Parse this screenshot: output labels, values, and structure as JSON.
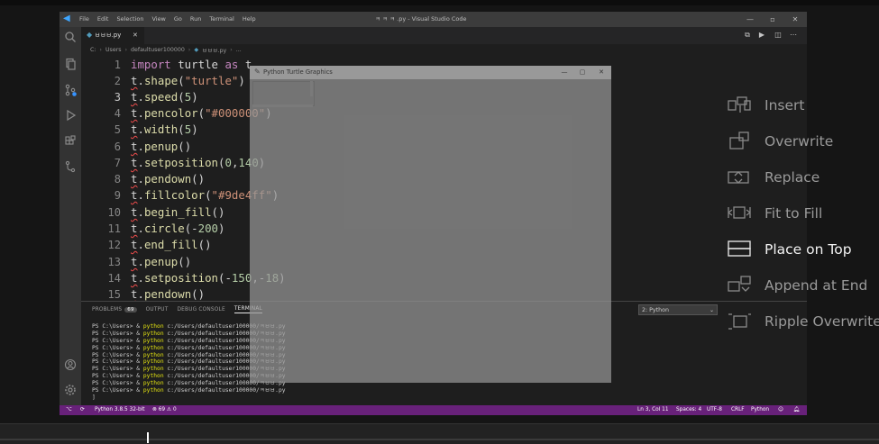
{
  "vscode": {
    "window_title": "ㅋ ㅋ ㅋ .py - Visual Studio Code",
    "menu": [
      "File",
      "Edit",
      "Selection",
      "View",
      "Go",
      "Run",
      "Terminal",
      "Help"
    ],
    "win_min": "—",
    "win_max": "▫",
    "win_close": "✕",
    "tab": {
      "label": "ㅂㅂㅂ.py",
      "close": "✕"
    },
    "breadcrumb": [
      "C:",
      "Users",
      "defaultuser100000",
      "ㅂㅂㅂ.py",
      "..."
    ],
    "code_lines": [
      {
        "n": "1",
        "t": "import turtle as t"
      },
      {
        "n": "2",
        "t": "t.shape(\"turtle\")"
      },
      {
        "n": "3",
        "t": "t.speed(5)"
      },
      {
        "n": "4",
        "t": "t.pencolor(\"#000000\")"
      },
      {
        "n": "5",
        "t": "t.width(5)"
      },
      {
        "n": "6",
        "t": "t.penup()"
      },
      {
        "n": "7",
        "t": "t.setposition(0,140)"
      },
      {
        "n": "8",
        "t": "t.pendown()"
      },
      {
        "n": "9",
        "t": "t.fillcolor(\"#9de4ff\")"
      },
      {
        "n": "10",
        "t": "t.begin_fill()"
      },
      {
        "n": "11",
        "t": "t.circle(-200)"
      },
      {
        "n": "12",
        "t": "t.end_fill()"
      },
      {
        "n": "13",
        "t": "t.penup()"
      },
      {
        "n": "14",
        "t": "t.setposition(-150,-18)"
      },
      {
        "n": "15",
        "t": "t.pendown()"
      }
    ],
    "turtle_window": {
      "title": "Python Turtle Graphics",
      "min": "—",
      "max": "▢",
      "close": "✕"
    },
    "panel": {
      "tabs": [
        "PROBLEMS",
        "OUTPUT",
        "DEBUG CONSOLE",
        "TERMINAL"
      ],
      "problems_count": "69",
      "terminal_select": "2: Python",
      "terminal_lines": [
        "PS C:\\Users> & python c:/Users/defaultuser100000/ㅋㅂㅂ.py",
        "PS C:\\Users> & python c:/Users/defaultuser100000/ㅋㅂㅂ.py",
        "PS C:\\Users> & python c:/Users/defaultuser100000/ㅋㅂㅂ.py",
        "PS C:\\Users> & python c:/Users/defaultuser100000/ㅋㅂㅂ.py",
        "PS C:\\Users> & python c:/Users/defaultuser100000/ㅋㅂㅂ.py",
        "PS C:\\Users> & python c:/Users/defaultuser100000/ㅋㅂㅂ.py",
        "PS C:\\Users> & python c:/Users/defaultuser100000/ㅋㅂㅂ.py",
        "PS C:\\Users> & python c:/Users/defaultuser100000/ㅋㅂㅂ.py",
        "PS C:\\Users> & python c:/Users/defaultuser100000/ㅋㅂㅂ.py",
        "PS C:\\Users> & python c:/Users/defaultuser100000/ㅋㅂㅂ.py",
        "]"
      ]
    },
    "status": {
      "python_env": "Python 3.8.5 32-bit",
      "problems": "⊗ 69 ⚠ 0",
      "position": "Ln 3, Col 11",
      "spaces": "Spaces: 4",
      "encoding": "UTF-8",
      "eol": "CRLF",
      "language": "Python"
    }
  },
  "context_menu": {
    "items": [
      {
        "label": "Insert",
        "icon": "insert-icon"
      },
      {
        "label": "Overwrite",
        "icon": "overwrite-icon"
      },
      {
        "label": "Replace",
        "icon": "replace-icon"
      },
      {
        "label": "Fit to Fill",
        "icon": "fit-to-fill-icon"
      },
      {
        "label": "Place on Top",
        "icon": "place-on-top-icon",
        "highlighted": true
      },
      {
        "label": "Append at End",
        "icon": "append-at-end-icon"
      },
      {
        "label": "Ripple Overwrite",
        "icon": "ripple-overwrite-icon"
      }
    ]
  },
  "colors": {
    "status_bar": "#68217a",
    "editor_bg": "#1e1e1e",
    "keyword": "#c586c0",
    "string": "#ce9178",
    "number": "#b5cea8",
    "squiggle": "#f14c4c"
  }
}
